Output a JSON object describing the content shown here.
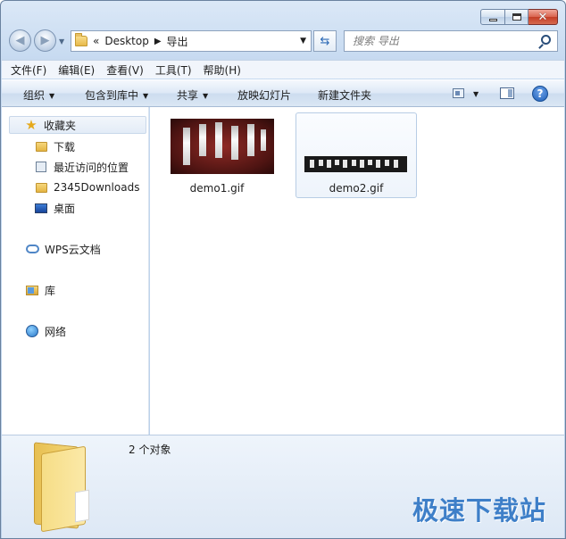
{
  "window": {
    "caption": {
      "minimize": "",
      "maximize": "",
      "close": "✕"
    }
  },
  "address": {
    "overflow": "«",
    "crumbs": [
      "Desktop",
      "导出"
    ]
  },
  "search": {
    "placeholder": "搜索 导出"
  },
  "menu": [
    "文件(F)",
    "编辑(E)",
    "查看(V)",
    "工具(T)",
    "帮助(H)"
  ],
  "toolbar": {
    "organize": "组织",
    "include": "包含到库中",
    "share": "共享",
    "slideshow": "放映幻灯片",
    "new_folder": "新建文件夹",
    "help": "?"
  },
  "sidebar": {
    "favorites": "收藏夹",
    "items": [
      "下载",
      "最近访问的位置",
      "2345Downloads",
      "桌面"
    ],
    "wps": "WPS云文档",
    "library": "库",
    "network": "网络"
  },
  "files": [
    {
      "name": "demo1.gif",
      "selected": false
    },
    {
      "name": "demo2.gif",
      "selected": true
    }
  ],
  "details": {
    "count": "2 个对象"
  },
  "watermark": "极速下载站",
  "icons": {
    "back": "arrow-left-icon",
    "forward": "arrow-right-icon",
    "refresh": "refresh-icon",
    "search": "magnifier-icon",
    "favorites": "star-icon",
    "folder": "folder-icon",
    "recent": "recent-places-icon",
    "desktop": "monitor-icon",
    "cloud": "cloud-icon",
    "library": "library-icon",
    "network": "globe-icon"
  }
}
